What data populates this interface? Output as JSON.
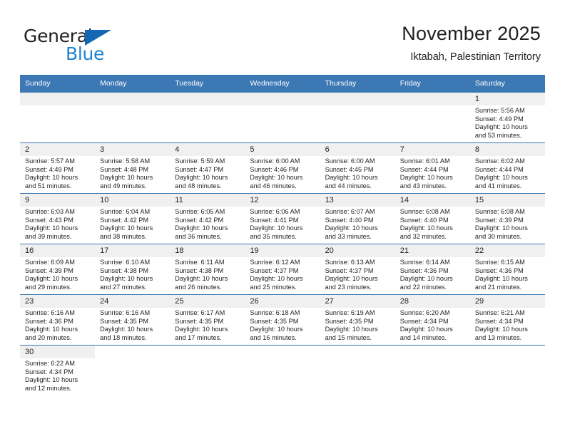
{
  "brand": {
    "name_part1": "General",
    "name_part2": "Blue",
    "triangle_color": "#1268b3",
    "blue_color": "#1f83d0"
  },
  "header": {
    "month_title": "November 2025",
    "location": "Iktabah, Palestinian Territory",
    "header_bg": "#3c78b4",
    "daynum_bg": "#f0f0f0"
  },
  "weekday_headers": [
    "Sunday",
    "Monday",
    "Tuesday",
    "Wednesday",
    "Thursday",
    "Friday",
    "Saturday"
  ],
  "labels": {
    "sunrise": "Sunrise:",
    "sunset": "Sunset:",
    "daylight": "Daylight:"
  },
  "weeks": [
    [
      {
        "day": "",
        "blank": true
      },
      {
        "day": "",
        "blank": true
      },
      {
        "day": "",
        "blank": true
      },
      {
        "day": "",
        "blank": true
      },
      {
        "day": "",
        "blank": true
      },
      {
        "day": "",
        "blank": true
      },
      {
        "day": "1",
        "sunrise": "Sunrise: 5:56 AM",
        "sunset": "Sunset: 4:49 PM",
        "daylight_1": "Daylight: 10 hours",
        "daylight_2": "and 53 minutes."
      }
    ],
    [
      {
        "day": "2",
        "sunrise": "Sunrise: 5:57 AM",
        "sunset": "Sunset: 4:49 PM",
        "daylight_1": "Daylight: 10 hours",
        "daylight_2": "and 51 minutes."
      },
      {
        "day": "3",
        "sunrise": "Sunrise: 5:58 AM",
        "sunset": "Sunset: 4:48 PM",
        "daylight_1": "Daylight: 10 hours",
        "daylight_2": "and 49 minutes."
      },
      {
        "day": "4",
        "sunrise": "Sunrise: 5:59 AM",
        "sunset": "Sunset: 4:47 PM",
        "daylight_1": "Daylight: 10 hours",
        "daylight_2": "and 48 minutes."
      },
      {
        "day": "5",
        "sunrise": "Sunrise: 6:00 AM",
        "sunset": "Sunset: 4:46 PM",
        "daylight_1": "Daylight: 10 hours",
        "daylight_2": "and 46 minutes."
      },
      {
        "day": "6",
        "sunrise": "Sunrise: 6:00 AM",
        "sunset": "Sunset: 4:45 PM",
        "daylight_1": "Daylight: 10 hours",
        "daylight_2": "and 44 minutes."
      },
      {
        "day": "7",
        "sunrise": "Sunrise: 6:01 AM",
        "sunset": "Sunset: 4:44 PM",
        "daylight_1": "Daylight: 10 hours",
        "daylight_2": "and 43 minutes."
      },
      {
        "day": "8",
        "sunrise": "Sunrise: 6:02 AM",
        "sunset": "Sunset: 4:44 PM",
        "daylight_1": "Daylight: 10 hours",
        "daylight_2": "and 41 minutes."
      }
    ],
    [
      {
        "day": "9",
        "sunrise": "Sunrise: 6:03 AM",
        "sunset": "Sunset: 4:43 PM",
        "daylight_1": "Daylight: 10 hours",
        "daylight_2": "and 39 minutes."
      },
      {
        "day": "10",
        "sunrise": "Sunrise: 6:04 AM",
        "sunset": "Sunset: 4:42 PM",
        "daylight_1": "Daylight: 10 hours",
        "daylight_2": "and 38 minutes."
      },
      {
        "day": "11",
        "sunrise": "Sunrise: 6:05 AM",
        "sunset": "Sunset: 4:42 PM",
        "daylight_1": "Daylight: 10 hours",
        "daylight_2": "and 36 minutes."
      },
      {
        "day": "12",
        "sunrise": "Sunrise: 6:06 AM",
        "sunset": "Sunset: 4:41 PM",
        "daylight_1": "Daylight: 10 hours",
        "daylight_2": "and 35 minutes."
      },
      {
        "day": "13",
        "sunrise": "Sunrise: 6:07 AM",
        "sunset": "Sunset: 4:40 PM",
        "daylight_1": "Daylight: 10 hours",
        "daylight_2": "and 33 minutes."
      },
      {
        "day": "14",
        "sunrise": "Sunrise: 6:08 AM",
        "sunset": "Sunset: 4:40 PM",
        "daylight_1": "Daylight: 10 hours",
        "daylight_2": "and 32 minutes."
      },
      {
        "day": "15",
        "sunrise": "Sunrise: 6:08 AM",
        "sunset": "Sunset: 4:39 PM",
        "daylight_1": "Daylight: 10 hours",
        "daylight_2": "and 30 minutes."
      }
    ],
    [
      {
        "day": "16",
        "sunrise": "Sunrise: 6:09 AM",
        "sunset": "Sunset: 4:39 PM",
        "daylight_1": "Daylight: 10 hours",
        "daylight_2": "and 29 minutes."
      },
      {
        "day": "17",
        "sunrise": "Sunrise: 6:10 AM",
        "sunset": "Sunset: 4:38 PM",
        "daylight_1": "Daylight: 10 hours",
        "daylight_2": "and 27 minutes."
      },
      {
        "day": "18",
        "sunrise": "Sunrise: 6:11 AM",
        "sunset": "Sunset: 4:38 PM",
        "daylight_1": "Daylight: 10 hours",
        "daylight_2": "and 26 minutes."
      },
      {
        "day": "19",
        "sunrise": "Sunrise: 6:12 AM",
        "sunset": "Sunset: 4:37 PM",
        "daylight_1": "Daylight: 10 hours",
        "daylight_2": "and 25 minutes."
      },
      {
        "day": "20",
        "sunrise": "Sunrise: 6:13 AM",
        "sunset": "Sunset: 4:37 PM",
        "daylight_1": "Daylight: 10 hours",
        "daylight_2": "and 23 minutes."
      },
      {
        "day": "21",
        "sunrise": "Sunrise: 6:14 AM",
        "sunset": "Sunset: 4:36 PM",
        "daylight_1": "Daylight: 10 hours",
        "daylight_2": "and 22 minutes."
      },
      {
        "day": "22",
        "sunrise": "Sunrise: 6:15 AM",
        "sunset": "Sunset: 4:36 PM",
        "daylight_1": "Daylight: 10 hours",
        "daylight_2": "and 21 minutes."
      }
    ],
    [
      {
        "day": "23",
        "sunrise": "Sunrise: 6:16 AM",
        "sunset": "Sunset: 4:36 PM",
        "daylight_1": "Daylight: 10 hours",
        "daylight_2": "and 20 minutes."
      },
      {
        "day": "24",
        "sunrise": "Sunrise: 6:16 AM",
        "sunset": "Sunset: 4:35 PM",
        "daylight_1": "Daylight: 10 hours",
        "daylight_2": "and 18 minutes."
      },
      {
        "day": "25",
        "sunrise": "Sunrise: 6:17 AM",
        "sunset": "Sunset: 4:35 PM",
        "daylight_1": "Daylight: 10 hours",
        "daylight_2": "and 17 minutes."
      },
      {
        "day": "26",
        "sunrise": "Sunrise: 6:18 AM",
        "sunset": "Sunset: 4:35 PM",
        "daylight_1": "Daylight: 10 hours",
        "daylight_2": "and 16 minutes."
      },
      {
        "day": "27",
        "sunrise": "Sunrise: 6:19 AM",
        "sunset": "Sunset: 4:35 PM",
        "daylight_1": "Daylight: 10 hours",
        "daylight_2": "and 15 minutes."
      },
      {
        "day": "28",
        "sunrise": "Sunrise: 6:20 AM",
        "sunset": "Sunset: 4:34 PM",
        "daylight_1": "Daylight: 10 hours",
        "daylight_2": "and 14 minutes."
      },
      {
        "day": "29",
        "sunrise": "Sunrise: 6:21 AM",
        "sunset": "Sunset: 4:34 PM",
        "daylight_1": "Daylight: 10 hours",
        "daylight_2": "and 13 minutes."
      }
    ],
    [
      {
        "day": "30",
        "sunrise": "Sunrise: 6:22 AM",
        "sunset": "Sunset: 4:34 PM",
        "daylight_1": "Daylight: 10 hours",
        "daylight_2": "and 12 minutes."
      },
      {
        "day": "",
        "blank": true,
        "nobg": true
      },
      {
        "day": "",
        "blank": true,
        "nobg": true
      },
      {
        "day": "",
        "blank": true,
        "nobg": true
      },
      {
        "day": "",
        "blank": true,
        "nobg": true
      },
      {
        "day": "",
        "blank": true,
        "nobg": true
      },
      {
        "day": "",
        "blank": true,
        "nobg": true
      }
    ]
  ]
}
